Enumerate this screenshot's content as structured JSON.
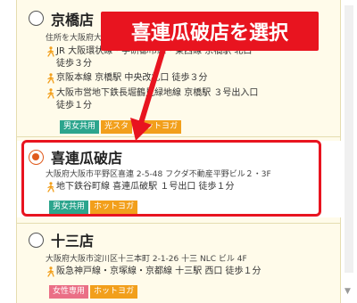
{
  "annotation": {
    "callout_text": "喜連瓜破店を選択"
  },
  "stores": [
    {
      "name": "京橋店",
      "selected": false,
      "address": "住所を大阪府大阪",
      "access": [
        "JR 大阪環状線・学研都市線・東西線 京橋駅 北口",
        "徒歩３分",
        "京阪本線 京橋駅 中央改札口 徒歩３分",
        "大阪市営地下鉄長堀鶴見緑地線 京橋駅 ３号出入口",
        "徒歩１分"
      ],
      "tags": [
        {
          "label": "男女共用",
          "color": "#2ca58d"
        },
        {
          "label": "光スタ",
          "color": "#f29f1b"
        },
        {
          "label": "ホットヨガ",
          "color": "#f29f1b"
        }
      ]
    },
    {
      "name": "喜連瓜破店",
      "selected": true,
      "address": "大阪府大阪市平野区喜連 2-5-48 フクダ不動産平野ビル２・3F",
      "access": [
        "地下鉄谷町線 喜連瓜破駅 １号出口 徒歩１分"
      ],
      "tags": [
        {
          "label": "男女共用",
          "color": "#2ca58d"
        },
        {
          "label": "ホットヨガ",
          "color": "#f29f1b"
        }
      ]
    },
    {
      "name": "十三店",
      "selected": false,
      "address": "大阪府大阪市淀川区十三本町 2-1-26 十三 NLC ビル 4F",
      "access": [
        "阪急神戸線・京塚線・京都線 十三駅 西口 徒歩１分"
      ],
      "tags": [
        {
          "label": "女性専用",
          "color": "#ea6f86"
        },
        {
          "label": "ホットヨガ",
          "color": "#f29f1b"
        }
      ]
    }
  ]
}
